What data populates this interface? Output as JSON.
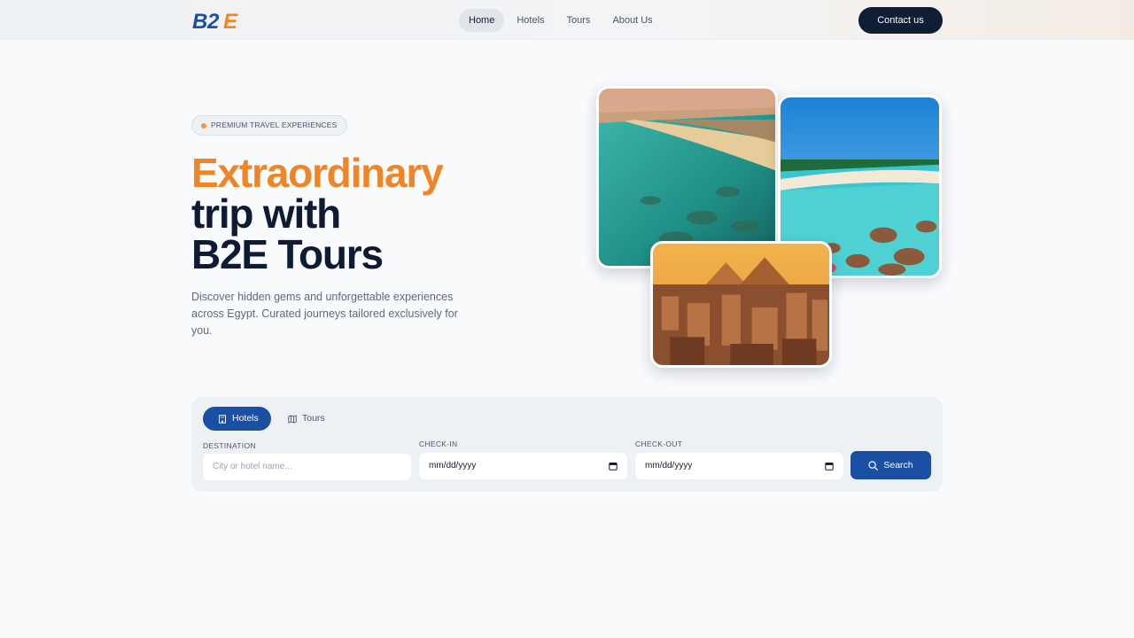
{
  "brand": {
    "logo_text": "B2E",
    "primary_color": "#1a4fa3",
    "accent_color": "#f08526"
  },
  "nav": {
    "items": [
      {
        "label": "Home",
        "active": true
      },
      {
        "label": "Hotels",
        "active": false
      },
      {
        "label": "Tours",
        "active": false
      },
      {
        "label": "About Us",
        "active": false
      }
    ],
    "contact_label": "Contact us"
  },
  "hero": {
    "badge": "PREMIUM TRAVEL EXPERIENCES",
    "headline_line1": "Extraordinary",
    "headline_line2": "trip with",
    "headline_line3": "B2E Tours",
    "subtext": "Discover hidden gems and unforgettable experiences across Egypt. Curated journeys tailored exclusively for you."
  },
  "search": {
    "tabs": [
      {
        "label": "Hotels",
        "icon": "building-icon",
        "active": true
      },
      {
        "label": "Tours",
        "icon": "map-icon",
        "active": false
      }
    ],
    "destination_label": "DESTINATION",
    "destination_placeholder": "City or hotel name...",
    "checkin_label": "CHECK-IN",
    "checkin_value": "mm/dd/yyyy",
    "checkout_label": "CHECK-OUT",
    "checkout_value": "mm/dd/yyyy",
    "button_label": "Search"
  }
}
